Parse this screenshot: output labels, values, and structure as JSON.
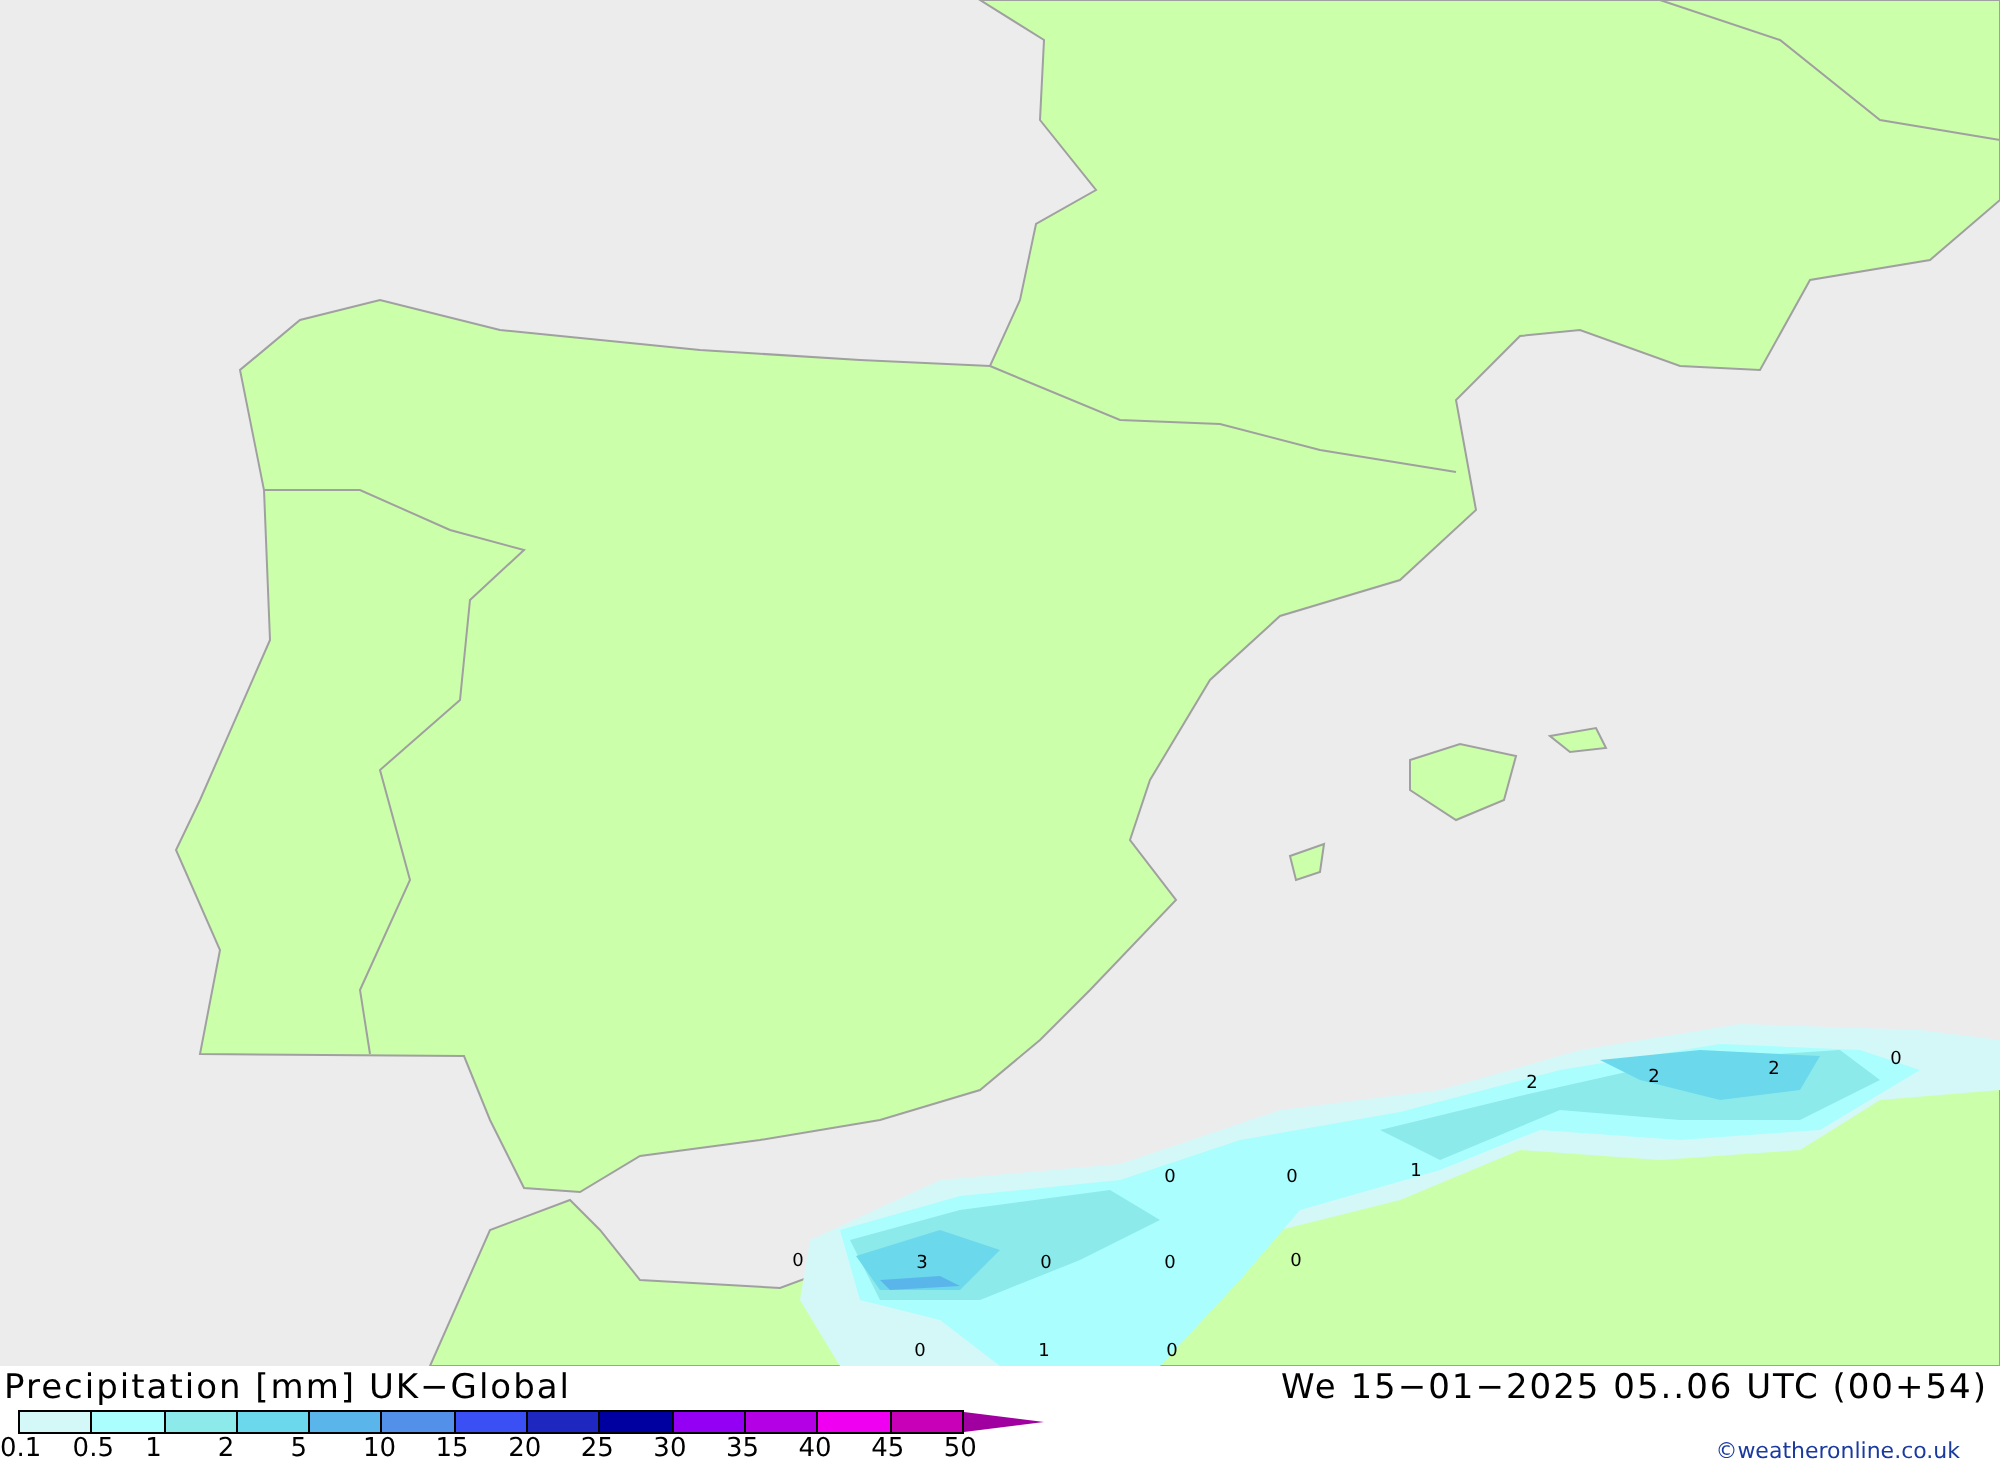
{
  "map": {
    "labels": [
      {
        "value": "2"
      },
      {
        "value": "2"
      },
      {
        "value": "2"
      },
      {
        "value": "0"
      },
      {
        "value": "0"
      },
      {
        "value": "0"
      },
      {
        "value": "1"
      },
      {
        "value": "0"
      },
      {
        "value": "3"
      },
      {
        "value": "0"
      },
      {
        "value": "0"
      },
      {
        "value": "0"
      },
      {
        "value": "0"
      },
      {
        "value": "1"
      },
      {
        "value": "0"
      }
    ]
  },
  "footer": {
    "title": "Precipitation [mm] UK−Global",
    "valid_time": "We 15−01−2025 05..06 UTC (00+54)",
    "copyright": "©weatheronline.co.uk"
  },
  "legend": {
    "bins": [
      {
        "color": "#d4f8f8"
      },
      {
        "color": "#aafefe"
      },
      {
        "color": "#8ceaea"
      },
      {
        "color": "#6cd8ec"
      },
      {
        "color": "#5ab6ea"
      },
      {
        "color": "#5290ea"
      },
      {
        "color": "#3a50f4"
      },
      {
        "color": "#1e28c0"
      },
      {
        "color": "#0000a0"
      },
      {
        "color": "#9400f4"
      },
      {
        "color": "#b400e4"
      },
      {
        "color": "#f000f0"
      },
      {
        "color": "#c800b8"
      }
    ],
    "ticks": [
      "0.1",
      "0.5",
      "1",
      "2",
      "5",
      "10",
      "15",
      "20",
      "25",
      "30",
      "35",
      "40",
      "45",
      "50"
    ]
  }
}
